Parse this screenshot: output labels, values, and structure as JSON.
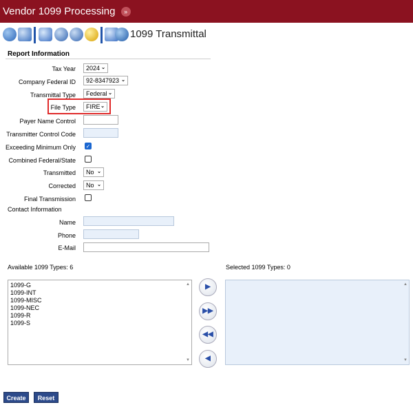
{
  "titlebar": {
    "title": "Vendor 1099 Processing",
    "chevron": "»"
  },
  "toolbar": {
    "title": "1099 Transmittal",
    "icons": [
      "globe-edit-icon",
      "open-folder-icon",
      "list-icon",
      "disks-icon",
      "disk-search-icon",
      "key-icon",
      "report-icon",
      "globe-icon"
    ]
  },
  "report": {
    "section_title": "Report Information",
    "tax_year": {
      "label": "Tax Year",
      "value": "2024"
    },
    "company_federal_id": {
      "label": "Company Federal ID",
      "value": "92-8347923"
    },
    "transmittal_type": {
      "label": "Transmittal Type",
      "value": "Federal"
    },
    "file_type": {
      "label": "File Type",
      "value": "FIRE"
    },
    "payer_name_control": {
      "label": "Payer Name Control",
      "value": ""
    },
    "transmitter_control_code": {
      "label": "Transmitter Control Code",
      "value": ""
    },
    "exceeding_minimum_only": {
      "label": "Exceeding Minimum Only",
      "checked": true
    },
    "combined_federal_state": {
      "label": "Combined Federal/State",
      "checked": false
    },
    "transmitted": {
      "label": "Transmitted",
      "value": "No"
    },
    "corrected": {
      "label": "Corrected",
      "value": "No"
    },
    "final_transmission": {
      "label": "Final Transmission",
      "checked": false
    }
  },
  "contact": {
    "section_title": "Contact Information",
    "name": {
      "label": "Name",
      "value": ""
    },
    "phone": {
      "label": "Phone",
      "value": ""
    },
    "email": {
      "label": "E-Mail",
      "value": ""
    }
  },
  "types": {
    "available_label": "Available 1099 Types: 6",
    "selected_label": "Selected 1099 Types: 0",
    "available": [
      "1099-G",
      "1099-INT",
      "1099-MISC",
      "1099-NEC",
      "1099-R",
      "1099-S"
    ],
    "selected": []
  },
  "actions": {
    "create": "Create",
    "reset": "Reset"
  },
  "colors": {
    "titlebar": "#8b1220",
    "button": "#2c4a8a",
    "highlight": "#e02a2a",
    "checkbox": "#1a66d0"
  }
}
